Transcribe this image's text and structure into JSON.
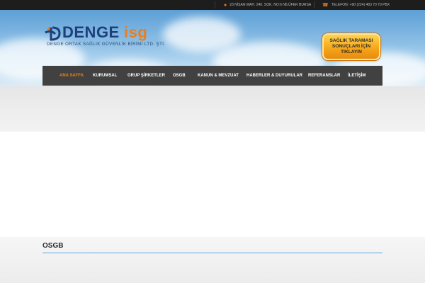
{
  "topbar": {
    "address": "23 NİSAN MAH. 240. SOK. NO:6 NİLÜFER BURSA",
    "phone": "TELEFON: +90 (224) 483 70 70 PBX",
    "address_icon": "map-pin-icon",
    "phone_icon": "phone-icon"
  },
  "logo": {
    "word1": "DENGE",
    "word2": "isg",
    "subtitle": "DENGE ORTAK SAĞLIK GÜVENLİK BİRİMİ LTD. ŞTİ."
  },
  "cta": {
    "label": "SAĞLIK TARAMASI SONUÇLARI İÇİN TIKLAYIN"
  },
  "nav": {
    "items": [
      {
        "label": "ANA SAYFA",
        "active": true
      },
      {
        "label": "KURUMSAL",
        "active": false
      },
      {
        "label": "GRUP ŞİRKETLER",
        "active": false
      },
      {
        "label": "OSGB",
        "active": false
      },
      {
        "label": "KANUN & MEVZUAT",
        "active": false
      },
      {
        "label": "HABERLER & DUYURULAR",
        "active": false
      },
      {
        "label": "REFERANSLAR",
        "active": false
      },
      {
        "label": "İLETİŞİM",
        "active": false
      }
    ]
  },
  "section": {
    "title": "OSGB"
  },
  "colors": {
    "accent": "#e87f1f",
    "brand_blue": "#1d3f7a",
    "nav_bg": "#414141",
    "topbar_bg": "#1d1d1d",
    "rule": "#5aa7d8"
  }
}
